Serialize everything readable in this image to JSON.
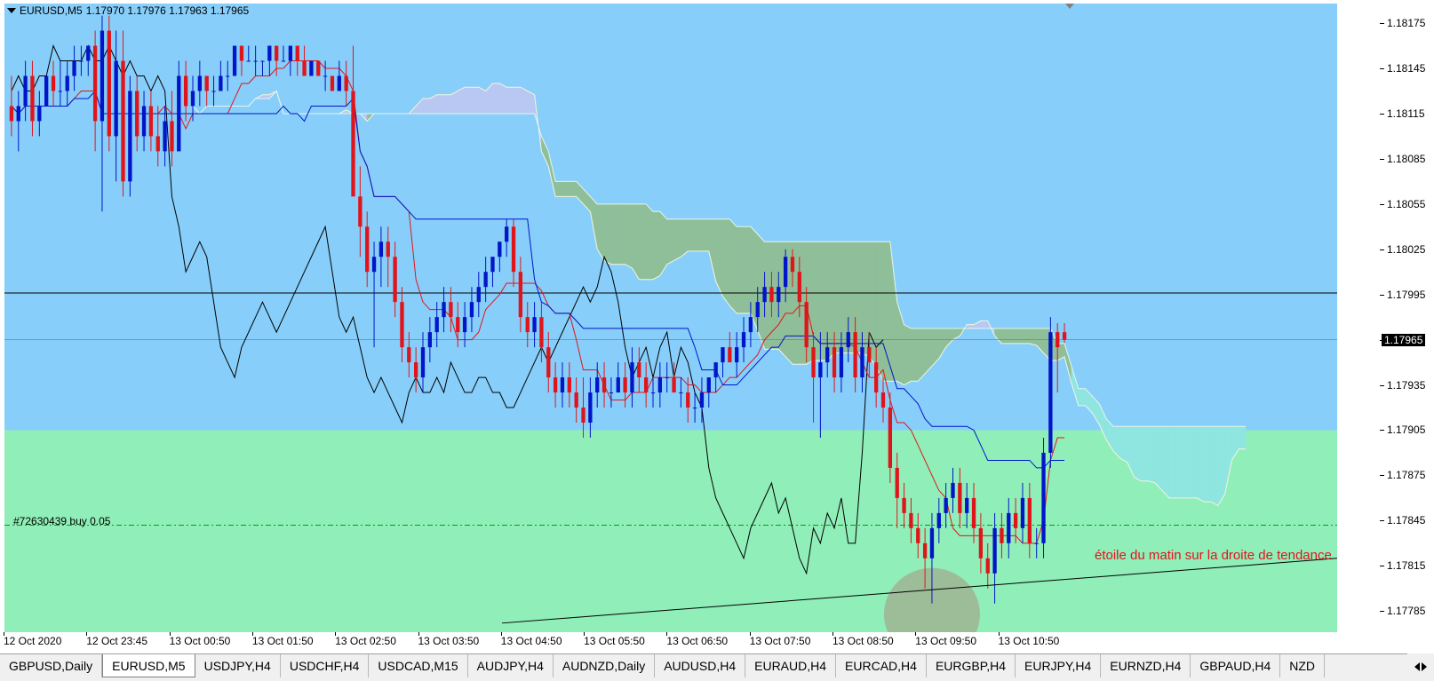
{
  "chart_header": {
    "symbol_timeframe": "EURUSD,M5",
    "ohlc": "1.17970 1.17976 1.17963 1.17965"
  },
  "colors": {
    "background_upper": "#87cefa",
    "background_lower": "#90eeb9",
    "bull_candle": "#0015c8",
    "bear_candle": "#e0151b",
    "tenkan": "#e0151b",
    "kijun": "#0015c8",
    "chikou": "#000000",
    "cloud_bullish": "#8fbf99",
    "cloud_bearish": "#b8c8f2",
    "projection_cloud": "#8fe5e0"
  },
  "price_axis": {
    "labels": [
      "1.18175",
      "1.18145",
      "1.18115",
      "1.18085",
      "1.18055",
      "1.18025",
      "1.17995",
      "1.17965",
      "1.17935",
      "1.17905",
      "1.17875",
      "1.17845",
      "1.17815",
      "1.17785"
    ],
    "current_price": "1.17965"
  },
  "time_axis": {
    "labels": [
      "12 Oct 2020",
      "12 Oct 23:45",
      "13 Oct 00:50",
      "13 Oct 01:50",
      "13 Oct 02:50",
      "13 Oct 03:50",
      "13 Oct 04:50",
      "13 Oct 05:50",
      "13 Oct 06:50",
      "13 Oct 07:50",
      "13 Oct 08:50",
      "13 Oct 09:50",
      "13 Oct 10:50"
    ]
  },
  "order": {
    "label": "#72630439 buy 0.05",
    "price": 1.17842
  },
  "horizontal_line_price": 1.17996,
  "zone_boundary_price": 1.17905,
  "annotation": "étoile du matin sur la droite de tendance",
  "trendline": {
    "start": {
      "time": "13 Oct 04:50",
      "price": 1.17777
    },
    "end": {
      "time": "13 Oct 12:10",
      "price": 1.1782
    }
  },
  "tabs": [
    {
      "label": "GBPUSD,Daily",
      "active": false
    },
    {
      "label": "EURUSD,M5",
      "active": true
    },
    {
      "label": "USDJPY,H4",
      "active": false
    },
    {
      "label": "USDCHF,H4",
      "active": false
    },
    {
      "label": "USDCAD,M15",
      "active": false
    },
    {
      "label": "AUDJPY,H4",
      "active": false
    },
    {
      "label": "AUDNZD,Daily",
      "active": false
    },
    {
      "label": "AUDUSD,H4",
      "active": false
    },
    {
      "label": "EURAUD,H4",
      "active": false
    },
    {
      "label": "EURCAD,H4",
      "active": false
    },
    {
      "label": "EURGBP,H4",
      "active": false
    },
    {
      "label": "EURJPY,H4",
      "active": false
    },
    {
      "label": "EURNZD,H4",
      "active": false
    },
    {
      "label": "GBPAUD,H4",
      "active": false
    },
    {
      "label": "NZD",
      "active": false
    }
  ],
  "chart_data": {
    "type": "candlestick",
    "price_range": [
      1.17771,
      1.18188
    ],
    "candles": [
      {
        "o": 1.1812,
        "h": 1.1814,
        "l": 1.181,
        "c": 1.1811
      },
      {
        "o": 1.1811,
        "h": 1.1813,
        "l": 1.1809,
        "c": 1.1812
      },
      {
        "o": 1.1812,
        "h": 1.1815,
        "l": 1.1811,
        "c": 1.1814
      },
      {
        "o": 1.1814,
        "h": 1.1815,
        "l": 1.181,
        "c": 1.1811
      },
      {
        "o": 1.1811,
        "h": 1.1813,
        "l": 1.181,
        "c": 1.1812
      },
      {
        "o": 1.1812,
        "h": 1.1814,
        "l": 1.1812,
        "c": 1.1814
      },
      {
        "o": 1.1814,
        "h": 1.1815,
        "l": 1.1812,
        "c": 1.1813
      },
      {
        "o": 1.1813,
        "h": 1.1815,
        "l": 1.1812,
        "c": 1.1813
      },
      {
        "o": 1.1813,
        "h": 1.1815,
        "l": 1.1812,
        "c": 1.1814
      },
      {
        "o": 1.1814,
        "h": 1.1816,
        "l": 1.1813,
        "c": 1.1815
      },
      {
        "o": 1.1815,
        "h": 1.1816,
        "l": 1.1814,
        "c": 1.1815
      },
      {
        "o": 1.1815,
        "h": 1.1816,
        "l": 1.1814,
        "c": 1.1816
      },
      {
        "o": 1.1816,
        "h": 1.1817,
        "l": 1.1809,
        "c": 1.1811
      },
      {
        "o": 1.1811,
        "h": 1.1818,
        "l": 1.1805,
        "c": 1.1817
      },
      {
        "o": 1.1817,
        "h": 1.1818,
        "l": 1.1809,
        "c": 1.181
      },
      {
        "o": 1.181,
        "h": 1.1817,
        "l": 1.1807,
        "c": 1.1815
      },
      {
        "o": 1.1815,
        "h": 1.1817,
        "l": 1.1806,
        "c": 1.1807
      },
      {
        "o": 1.1807,
        "h": 1.1814,
        "l": 1.1806,
        "c": 1.1813
      },
      {
        "o": 1.1813,
        "h": 1.1814,
        "l": 1.1809,
        "c": 1.181
      },
      {
        "o": 1.181,
        "h": 1.1813,
        "l": 1.1809,
        "c": 1.1812
      },
      {
        "o": 1.1812,
        "h": 1.1813,
        "l": 1.1809,
        "c": 1.181
      },
      {
        "o": 1.181,
        "h": 1.1812,
        "l": 1.1808,
        "c": 1.1809
      },
      {
        "o": 1.1809,
        "h": 1.1812,
        "l": 1.1808,
        "c": 1.1811
      },
      {
        "o": 1.1811,
        "h": 1.1813,
        "l": 1.1808,
        "c": 1.1809
      },
      {
        "o": 1.1809,
        "h": 1.1815,
        "l": 1.1809,
        "c": 1.1814
      },
      {
        "o": 1.1814,
        "h": 1.1815,
        "l": 1.1811,
        "c": 1.1812
      },
      {
        "o": 1.1812,
        "h": 1.1814,
        "l": 1.1811,
        "c": 1.1813
      },
      {
        "o": 1.1813,
        "h": 1.1815,
        "l": 1.1812,
        "c": 1.1814
      },
      {
        "o": 1.1814,
        "h": 1.1814,
        "l": 1.1812,
        "c": 1.1813
      },
      {
        "o": 1.1813,
        "h": 1.1814,
        "l": 1.1812,
        "c": 1.1813
      },
      {
        "o": 1.1813,
        "h": 1.1815,
        "l": 1.1813,
        "c": 1.1814
      },
      {
        "o": 1.1814,
        "h": 1.1815,
        "l": 1.1813,
        "c": 1.1814
      },
      {
        "o": 1.1814,
        "h": 1.1816,
        "l": 1.1814,
        "c": 1.1816
      },
      {
        "o": 1.1816,
        "h": 1.1816,
        "l": 1.1814,
        "c": 1.1815
      },
      {
        "o": 1.1815,
        "h": 1.1816,
        "l": 1.1815,
        "c": 1.1815
      },
      {
        "o": 1.1815,
        "h": 1.1816,
        "l": 1.1814,
        "c": 1.1815
      },
      {
        "o": 1.1815,
        "h": 1.1815,
        "l": 1.1814,
        "c": 1.1815
      },
      {
        "o": 1.1815,
        "h": 1.1816,
        "l": 1.1814,
        "c": 1.1816
      },
      {
        "o": 1.1816,
        "h": 1.1816,
        "l": 1.1814,
        "c": 1.1815
      },
      {
        "o": 1.1815,
        "h": 1.1816,
        "l": 1.1815,
        "c": 1.1815
      },
      {
        "o": 1.1815,
        "h": 1.1816,
        "l": 1.1814,
        "c": 1.1816
      },
      {
        "o": 1.1816,
        "h": 1.1816,
        "l": 1.1814,
        "c": 1.1815
      },
      {
        "o": 1.1815,
        "h": 1.1816,
        "l": 1.1814,
        "c": 1.1814
      },
      {
        "o": 1.1814,
        "h": 1.1815,
        "l": 1.1814,
        "c": 1.1815
      },
      {
        "o": 1.1815,
        "h": 1.1815,
        "l": 1.1814,
        "c": 1.1814
      },
      {
        "o": 1.1814,
        "h": 1.1815,
        "l": 1.1813,
        "c": 1.1814
      },
      {
        "o": 1.1814,
        "h": 1.1814,
        "l": 1.1813,
        "c": 1.1813
      },
      {
        "o": 1.1813,
        "h": 1.1815,
        "l": 1.1813,
        "c": 1.1814
      },
      {
        "o": 1.1814,
        "h": 1.1815,
        "l": 1.1812,
        "c": 1.1813
      },
      {
        "o": 1.1813,
        "h": 1.1816,
        "l": 1.181,
        "c": 1.1806
      },
      {
        "o": 1.1806,
        "h": 1.1808,
        "l": 1.1802,
        "c": 1.1804
      },
      {
        "o": 1.1804,
        "h": 1.1805,
        "l": 1.18,
        "c": 1.1801
      },
      {
        "o": 1.1801,
        "h": 1.1803,
        "l": 1.1796,
        "c": 1.1802
      },
      {
        "o": 1.1802,
        "h": 1.1804,
        "l": 1.18,
        "c": 1.1803
      },
      {
        "o": 1.1803,
        "h": 1.1804,
        "l": 1.18,
        "c": 1.1802
      },
      {
        "o": 1.1802,
        "h": 1.1803,
        "l": 1.1798,
        "c": 1.1799
      },
      {
        "o": 1.1799,
        "h": 1.18,
        "l": 1.1795,
        "c": 1.1796
      },
      {
        "o": 1.1796,
        "h": 1.1797,
        "l": 1.1794,
        "c": 1.1795
      },
      {
        "o": 1.1795,
        "h": 1.1796,
        "l": 1.1793,
        "c": 1.1794
      },
      {
        "o": 1.1794,
        "h": 1.1797,
        "l": 1.1793,
        "c": 1.1796
      },
      {
        "o": 1.1796,
        "h": 1.1798,
        "l": 1.1795,
        "c": 1.1797
      },
      {
        "o": 1.1797,
        "h": 1.1799,
        "l": 1.1796,
        "c": 1.1798
      },
      {
        "o": 1.1798,
        "h": 1.18,
        "l": 1.1797,
        "c": 1.1799
      },
      {
        "o": 1.1799,
        "h": 1.18,
        "l": 1.1797,
        "c": 1.1798
      },
      {
        "o": 1.1798,
        "h": 1.1799,
        "l": 1.1796,
        "c": 1.1797
      },
      {
        "o": 1.1797,
        "h": 1.1799,
        "l": 1.1796,
        "c": 1.1798
      },
      {
        "o": 1.1798,
        "h": 1.18,
        "l": 1.1797,
        "c": 1.1799
      },
      {
        "o": 1.1799,
        "h": 1.1801,
        "l": 1.1798,
        "c": 1.18
      },
      {
        "o": 1.18,
        "h": 1.1802,
        "l": 1.1799,
        "c": 1.1801
      },
      {
        "o": 1.1801,
        "h": 1.1802,
        "l": 1.18,
        "c": 1.1802
      },
      {
        "o": 1.1802,
        "h": 1.1803,
        "l": 1.1801,
        "c": 1.1803
      },
      {
        "o": 1.1803,
        "h": 1.18045,
        "l": 1.1802,
        "c": 1.1804
      },
      {
        "o": 1.1804,
        "h": 1.18045,
        "l": 1.18,
        "c": 1.1801
      },
      {
        "o": 1.1801,
        "h": 1.1802,
        "l": 1.1797,
        "c": 1.1798
      },
      {
        "o": 1.1798,
        "h": 1.1799,
        "l": 1.1796,
        "c": 1.1797
      },
      {
        "o": 1.1797,
        "h": 1.1799,
        "l": 1.1796,
        "c": 1.1798
      },
      {
        "o": 1.1798,
        "h": 1.1799,
        "l": 1.1795,
        "c": 1.1796
      },
      {
        "o": 1.1796,
        "h": 1.1797,
        "l": 1.1793,
        "c": 1.1794
      },
      {
        "o": 1.1794,
        "h": 1.1795,
        "l": 1.1792,
        "c": 1.1793
      },
      {
        "o": 1.1793,
        "h": 1.1795,
        "l": 1.1792,
        "c": 1.1794
      },
      {
        "o": 1.1794,
        "h": 1.1795,
        "l": 1.1792,
        "c": 1.1793
      },
      {
        "o": 1.1793,
        "h": 1.1794,
        "l": 1.1791,
        "c": 1.1792
      },
      {
        "o": 1.1792,
        "h": 1.1794,
        "l": 1.179,
        "c": 1.1791
      },
      {
        "o": 1.1791,
        "h": 1.1794,
        "l": 1.179,
        "c": 1.1793
      },
      {
        "o": 1.1793,
        "h": 1.1795,
        "l": 1.1792,
        "c": 1.1794
      },
      {
        "o": 1.1794,
        "h": 1.1795,
        "l": 1.1792,
        "c": 1.1793
      },
      {
        "o": 1.1793,
        "h": 1.1794,
        "l": 1.1792,
        "c": 1.1793
      },
      {
        "o": 1.1793,
        "h": 1.1795,
        "l": 1.1793,
        "c": 1.1794
      },
      {
        "o": 1.1794,
        "h": 1.1795,
        "l": 1.1792,
        "c": 1.1793
      },
      {
        "o": 1.1793,
        "h": 1.1796,
        "l": 1.1792,
        "c": 1.1795
      },
      {
        "o": 1.1795,
        "h": 1.1796,
        "l": 1.1793,
        "c": 1.1794
      },
      {
        "o": 1.1794,
        "h": 1.1795,
        "l": 1.1792,
        "c": 1.1793
      },
      {
        "o": 1.1793,
        "h": 1.1794,
        "l": 1.1792,
        "c": 1.1793
      },
      {
        "o": 1.1793,
        "h": 1.1795,
        "l": 1.1792,
        "c": 1.1794
      },
      {
        "o": 1.1794,
        "h": 1.1795,
        "l": 1.1793,
        "c": 1.1794
      },
      {
        "o": 1.1794,
        "h": 1.1795,
        "l": 1.1793,
        "c": 1.1793
      },
      {
        "o": 1.1793,
        "h": 1.1794,
        "l": 1.1792,
        "c": 1.1793
      },
      {
        "o": 1.1793,
        "h": 1.1794,
        "l": 1.1791,
        "c": 1.1792
      },
      {
        "o": 1.1792,
        "h": 1.1793,
        "l": 1.1791,
        "c": 1.1792
      },
      {
        "o": 1.1792,
        "h": 1.1794,
        "l": 1.1791,
        "c": 1.1793
      },
      {
        "o": 1.1793,
        "h": 1.1794,
        "l": 1.1792,
        "c": 1.1794
      },
      {
        "o": 1.1794,
        "h": 1.1795,
        "l": 1.1793,
        "c": 1.1795
      },
      {
        "o": 1.1795,
        "h": 1.1796,
        "l": 1.1794,
        "c": 1.1796
      },
      {
        "o": 1.1796,
        "h": 1.1797,
        "l": 1.1795,
        "c": 1.1795
      },
      {
        "o": 1.1795,
        "h": 1.1797,
        "l": 1.1794,
        "c": 1.1796
      },
      {
        "o": 1.1796,
        "h": 1.1798,
        "l": 1.1795,
        "c": 1.1797
      },
      {
        "o": 1.1797,
        "h": 1.1799,
        "l": 1.1796,
        "c": 1.1798
      },
      {
        "o": 1.1798,
        "h": 1.18,
        "l": 1.1797,
        "c": 1.1799
      },
      {
        "o": 1.1799,
        "h": 1.1801,
        "l": 1.1798,
        "c": 1.18
      },
      {
        "o": 1.18,
        "h": 1.1801,
        "l": 1.1798,
        "c": 1.1799
      },
      {
        "o": 1.1799,
        "h": 1.1801,
        "l": 1.1798,
        "c": 1.18
      },
      {
        "o": 1.18,
        "h": 1.18025,
        "l": 1.1799,
        "c": 1.1802
      },
      {
        "o": 1.1802,
        "h": 1.18025,
        "l": 1.18,
        "c": 1.1801
      },
      {
        "o": 1.1801,
        "h": 1.1802,
        "l": 1.1798,
        "c": 1.1799
      },
      {
        "o": 1.1799,
        "h": 1.18,
        "l": 1.1795,
        "c": 1.1796
      },
      {
        "o": 1.1796,
        "h": 1.1797,
        "l": 1.1791,
        "c": 1.1794
      },
      {
        "o": 1.1794,
        "h": 1.1797,
        "l": 1.179,
        "c": 1.1795
      },
      {
        "o": 1.1795,
        "h": 1.1797,
        "l": 1.1794,
        "c": 1.1796
      },
      {
        "o": 1.1796,
        "h": 1.1797,
        "l": 1.1793,
        "c": 1.1794
      },
      {
        "o": 1.1794,
        "h": 1.1797,
        "l": 1.1793,
        "c": 1.1796
      },
      {
        "o": 1.1796,
        "h": 1.1798,
        "l": 1.1795,
        "c": 1.1797
      },
      {
        "o": 1.1797,
        "h": 1.1798,
        "l": 1.1793,
        "c": 1.1794
      },
      {
        "o": 1.1794,
        "h": 1.1797,
        "l": 1.1793,
        "c": 1.1796
      },
      {
        "o": 1.1796,
        "h": 1.1797,
        "l": 1.1794,
        "c": 1.1795
      },
      {
        "o": 1.1795,
        "h": 1.1796,
        "l": 1.1792,
        "c": 1.1793
      },
      {
        "o": 1.1793,
        "h": 1.1794,
        "l": 1.1791,
        "c": 1.1792
      },
      {
        "o": 1.1792,
        "h": 1.1793,
        "l": 1.1787,
        "c": 1.1788
      },
      {
        "o": 1.1788,
        "h": 1.1789,
        "l": 1.1784,
        "c": 1.1786
      },
      {
        "o": 1.1786,
        "h": 1.1787,
        "l": 1.1784,
        "c": 1.1785
      },
      {
        "o": 1.1785,
        "h": 1.1786,
        "l": 1.1783,
        "c": 1.1784
      },
      {
        "o": 1.1784,
        "h": 1.1785,
        "l": 1.1782,
        "c": 1.1783
      },
      {
        "o": 1.1783,
        "h": 1.1784,
        "l": 1.178,
        "c": 1.1782
      },
      {
        "o": 1.1782,
        "h": 1.1785,
        "l": 1.1779,
        "c": 1.1784
      },
      {
        "o": 1.1784,
        "h": 1.1786,
        "l": 1.1783,
        "c": 1.1785
      },
      {
        "o": 1.1785,
        "h": 1.1787,
        "l": 1.1784,
        "c": 1.1786
      },
      {
        "o": 1.1786,
        "h": 1.1788,
        "l": 1.1785,
        "c": 1.1787
      },
      {
        "o": 1.1787,
        "h": 1.1788,
        "l": 1.1784,
        "c": 1.1785
      },
      {
        "o": 1.1785,
        "h": 1.1787,
        "l": 1.1784,
        "c": 1.1786
      },
      {
        "o": 1.1786,
        "h": 1.1787,
        "l": 1.1783,
        "c": 1.1784
      },
      {
        "o": 1.1784,
        "h": 1.1785,
        "l": 1.1781,
        "c": 1.1782
      },
      {
        "o": 1.1782,
        "h": 1.1783,
        "l": 1.178,
        "c": 1.1781
      },
      {
        "o": 1.1781,
        "h": 1.1785,
        "l": 1.1779,
        "c": 1.1784
      },
      {
        "o": 1.1784,
        "h": 1.1785,
        "l": 1.1782,
        "c": 1.1783
      },
      {
        "o": 1.1783,
        "h": 1.1786,
        "l": 1.1782,
        "c": 1.1785
      },
      {
        "o": 1.1785,
        "h": 1.1786,
        "l": 1.1783,
        "c": 1.1784
      },
      {
        "o": 1.1784,
        "h": 1.1787,
        "l": 1.1783,
        "c": 1.1786
      },
      {
        "o": 1.1786,
        "h": 1.1787,
        "l": 1.1782,
        "c": 1.1783
      },
      {
        "o": 1.1783,
        "h": 1.1784,
        "l": 1.1782,
        "c": 1.1783
      },
      {
        "o": 1.1783,
        "h": 1.179,
        "l": 1.1782,
        "c": 1.1789
      },
      {
        "o": 1.1789,
        "h": 1.1798,
        "l": 1.1788,
        "c": 1.1797
      },
      {
        "o": 1.1797,
        "h": 1.17976,
        "l": 1.1793,
        "c": 1.1796
      },
      {
        "o": 1.1797,
        "h": 1.17976,
        "l": 1.17963,
        "c": 1.17965
      }
    ]
  }
}
